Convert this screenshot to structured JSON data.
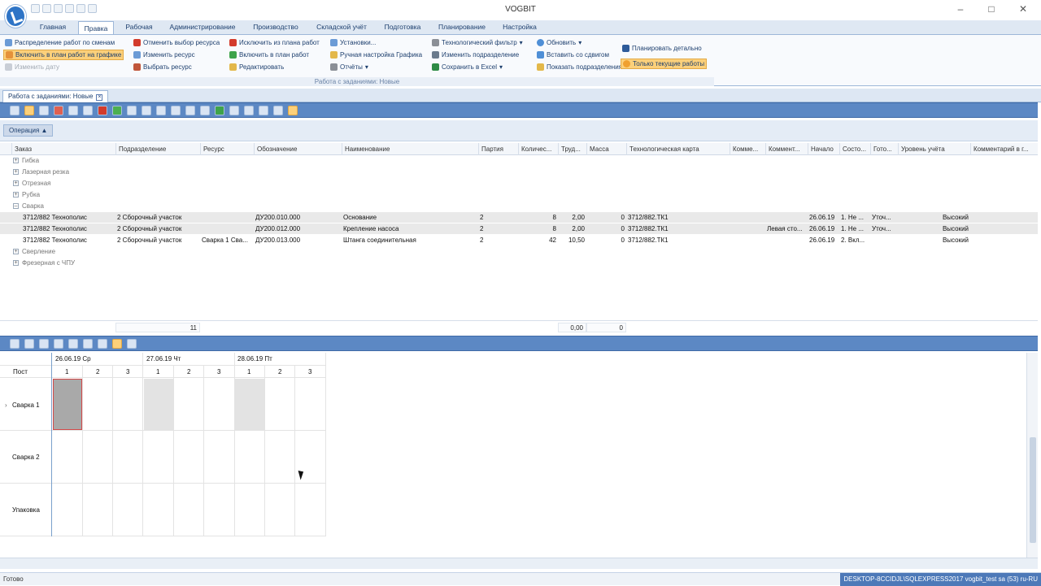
{
  "app": {
    "title": "VOGBIT"
  },
  "ribbon_tabs": [
    "Главная",
    "Правка",
    "Рабочая",
    "Администрирование",
    "Производство",
    "Складской учёт",
    "Подготовка",
    "Планирование",
    "Настройка"
  ],
  "ribbon": {
    "col1": [
      "Распределение работ по сменам",
      "Включить в план работ на графике",
      "Изменить дату"
    ],
    "col2": [
      "Отменить выбор ресурса",
      "Изменить ресурс",
      "Выбрать ресурс"
    ],
    "col3": [
      "Исключить из плана работ",
      "Включить в план работ",
      "Редактировать"
    ],
    "col4": [
      "Установки...",
      "Ручная настройка Графика",
      "Отчёты"
    ],
    "col5": [
      "Технологический фильтр",
      "Изменить подразделение",
      "Сохранить в Excel"
    ],
    "col6": [
      "Обновить",
      "Вставить со сдвигом",
      "Показать подразделения"
    ],
    "col7": [
      "Планировать детально",
      "Только текущие работы"
    ],
    "group_label": "Работа с заданиями: Новые"
  },
  "doc_tab": "Работа с заданиями: Новые",
  "group_button": "Операция",
  "columns": [
    "Заказ",
    "Подразделение",
    "Ресурс",
    "Обозначение",
    "Наименование",
    "Партия",
    "Количес...",
    "Труд...",
    "Масса",
    "Технологическая карта",
    "Комме...",
    "Коммент...",
    "Начало",
    "Состо...",
    "Гото...",
    "Уровень учёта",
    "Комментарий в г..."
  ],
  "groups_before": [
    "Гибка",
    "Лазерная резка",
    "Отрезная",
    "Рубка",
    "Сварка"
  ],
  "rows": [
    [
      "3712/882 Технополис",
      "2 Сборочный участок",
      "",
      "ДУ200.010.000",
      "Основание",
      "2",
      "8",
      "2,00",
      "0",
      "3712/882.ТК1",
      "",
      "",
      "26.06.19",
      "1. Не ...",
      "Уточ...",
      "Высокий",
      ""
    ],
    [
      "3712/882 Технополис",
      "2 Сборочный участок",
      "",
      "ДУ200.012.000",
      "Крепление насоса",
      "2",
      "8",
      "2,00",
      "0",
      "3712/882.ТК1",
      "",
      "Левая сто...",
      "26.06.19",
      "1. Не ...",
      "Уточ...",
      "Высокий",
      ""
    ],
    [
      "3712/882 Технополис",
      "2 Сборочный участок",
      "Сварка 1 Сва...",
      "ДУ200.013.000",
      "Штанга соединительная",
      "2",
      "42",
      "10,50",
      "0",
      "3712/882.ТК1",
      "",
      "",
      "26.06.19",
      "2. Вкл...",
      "",
      "Высокий",
      ""
    ]
  ],
  "groups_after": [
    "Сверление",
    "Фрезерная с ЧПУ"
  ],
  "footer": {
    "count": "11",
    "labor": "0,00",
    "mass": "0"
  },
  "schedule": {
    "post_header": "Пост",
    "days": [
      "26.06.19 Ср",
      "27.06.19 Чт",
      "28.06.19 Пт"
    ],
    "shifts": [
      "1",
      "2",
      "3",
      "1",
      "2",
      "3",
      "1",
      "2",
      "3"
    ],
    "posts": [
      "Сварка 1",
      "Сварка 2",
      "Упаковка"
    ]
  },
  "status": {
    "left": "Готово",
    "right": "DESKTOP-8CCIDJL\\SQLEXPRESS2017    vogbit_test    sa (53)    ru-RU"
  }
}
